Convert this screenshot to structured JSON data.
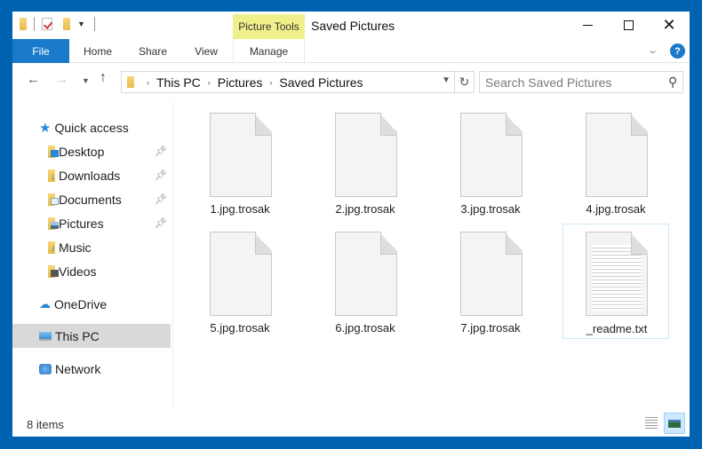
{
  "window": {
    "title": "Saved Pictures",
    "context_tab_group": "Picture Tools",
    "controls": {
      "minimize": "minimize",
      "maximize": "maximize",
      "close": "✕"
    }
  },
  "ribbon": {
    "tabs": [
      {
        "label": "File",
        "active": true
      },
      {
        "label": "Home"
      },
      {
        "label": "Share"
      },
      {
        "label": "View"
      },
      {
        "label": "Manage"
      }
    ],
    "help": "?",
    "expand": "⌄"
  },
  "nav": {
    "back": "←",
    "forward": "→",
    "recent": "⌄",
    "up": "↑",
    "breadcrumb": [
      "This PC",
      "Pictures",
      "Saved Pictures"
    ],
    "separator": "›",
    "dropdown": "⌄",
    "refresh": "↻"
  },
  "search": {
    "placeholder": "Search Saved Pictures",
    "value": "",
    "icon": "⚲"
  },
  "sidebar": {
    "items": [
      {
        "label": "Quick access",
        "icon": "star-icon"
      },
      {
        "label": "Desktop",
        "icon": "desktop-folder-icon",
        "pinned": true
      },
      {
        "label": "Downloads",
        "icon": "downloads-folder-icon",
        "pinned": true
      },
      {
        "label": "Documents",
        "icon": "documents-folder-icon",
        "pinned": true
      },
      {
        "label": "Pictures",
        "icon": "pictures-folder-icon",
        "pinned": true
      },
      {
        "label": "Music",
        "icon": "music-folder-icon"
      },
      {
        "label": "Videos",
        "icon": "videos-folder-icon"
      },
      {
        "label": "OneDrive",
        "icon": "cloud-icon"
      },
      {
        "label": "This PC",
        "icon": "computer-icon",
        "selected": true
      },
      {
        "label": "Network",
        "icon": "network-icon"
      }
    ]
  },
  "files": [
    {
      "name": "1.jpg.trosak",
      "type": "blank"
    },
    {
      "name": "2.jpg.trosak",
      "type": "blank"
    },
    {
      "name": "3.jpg.trosak",
      "type": "blank"
    },
    {
      "name": "4.jpg.trosak",
      "type": "blank"
    },
    {
      "name": "5.jpg.trosak",
      "type": "blank"
    },
    {
      "name": "6.jpg.trosak",
      "type": "blank"
    },
    {
      "name": "7.jpg.trosak",
      "type": "blank"
    },
    {
      "name": "_readme.txt",
      "type": "text",
      "focused": true
    }
  ],
  "status": {
    "count": "8 items"
  },
  "colors": {
    "frame": "#0063b1",
    "file_tab": "#1979ca",
    "context_tab": "#f0f08a",
    "selection": "#d9d9d9"
  }
}
